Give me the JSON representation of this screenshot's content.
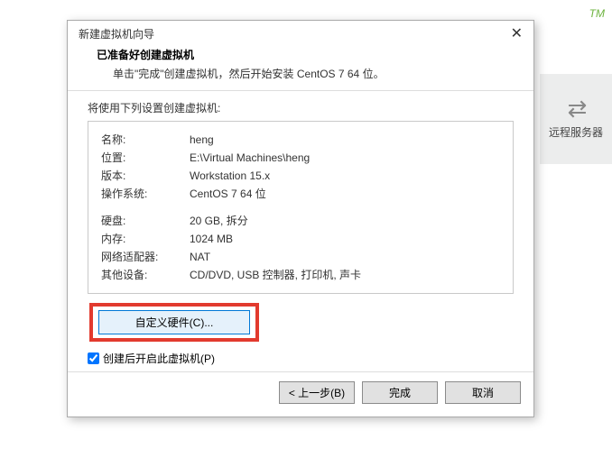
{
  "background": {
    "tm": "TM",
    "remote_label": "远程服务器"
  },
  "dialog": {
    "title": "新建虚拟机向导",
    "header_title": "已准备好创建虚拟机",
    "header_subtitle": "单击\"完成\"创建虚拟机，然后开始安装 CentOS 7 64 位。",
    "use_settings_label": "将使用下列设置创建虚拟机:"
  },
  "settings": {
    "name_label": "名称:",
    "name_value": "heng",
    "location_label": "位置:",
    "location_value": "E:\\Virtual Machines\\heng",
    "version_label": "版本:",
    "version_value": "Workstation 15.x",
    "os_label": "操作系统:",
    "os_value": "CentOS 7 64 位",
    "disk_label": "硬盘:",
    "disk_value": "20 GB, 拆分",
    "memory_label": "内存:",
    "memory_value": "1024 MB",
    "network_label": "网络适配器:",
    "network_value": "NAT",
    "other_label": "其他设备:",
    "other_value": "CD/DVD, USB 控制器, 打印机, 声卡"
  },
  "buttons": {
    "customize": "自定义硬件(C)...",
    "power_on_label": "创建后开启此虚拟机(P)",
    "back": "< 上一步(B)",
    "finish": "完成",
    "cancel": "取消"
  }
}
